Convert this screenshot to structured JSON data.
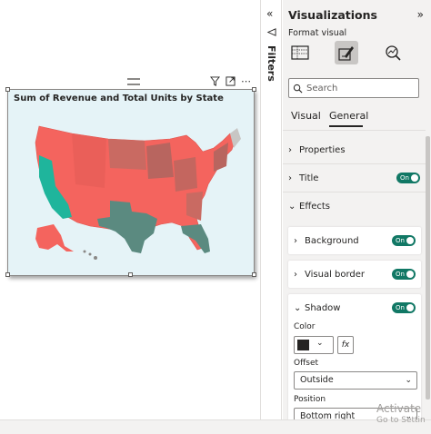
{
  "visual": {
    "title": "Sum of Revenue and Total Units by State",
    "icons": [
      "filter-icon",
      "focus-mode-icon",
      "more-options-icon"
    ]
  },
  "filters": {
    "label": "Filters"
  },
  "pane": {
    "title": "Visualizations",
    "subtitle": "Format visual",
    "search_placeholder": "Search",
    "tabs": [
      {
        "label": "Visual",
        "active": false
      },
      {
        "label": "General",
        "active": true
      }
    ],
    "sections": {
      "properties": "Properties",
      "title": "Title",
      "effects": "Effects",
      "background": "Background",
      "visual_border": "Visual border",
      "shadow": "Shadow"
    },
    "toggle_label": "On",
    "shadow": {
      "color_label": "Color",
      "color_value": "#252423",
      "fx_label": "fx",
      "offset_label": "Offset",
      "offset_value": "Outside",
      "position_label": "Position",
      "position_value": "Bottom right"
    }
  },
  "watermark": {
    "line1": "Activate",
    "line2": "Go to Settin"
  },
  "colors": {
    "accent_toggle": "#117865",
    "map_red": "#f4645e",
    "map_dark": "#b8655f",
    "map_teal": "#1fb59c",
    "map_gray_teal": "#5b8a80",
    "canvas_bg": "#e5f3f7"
  }
}
